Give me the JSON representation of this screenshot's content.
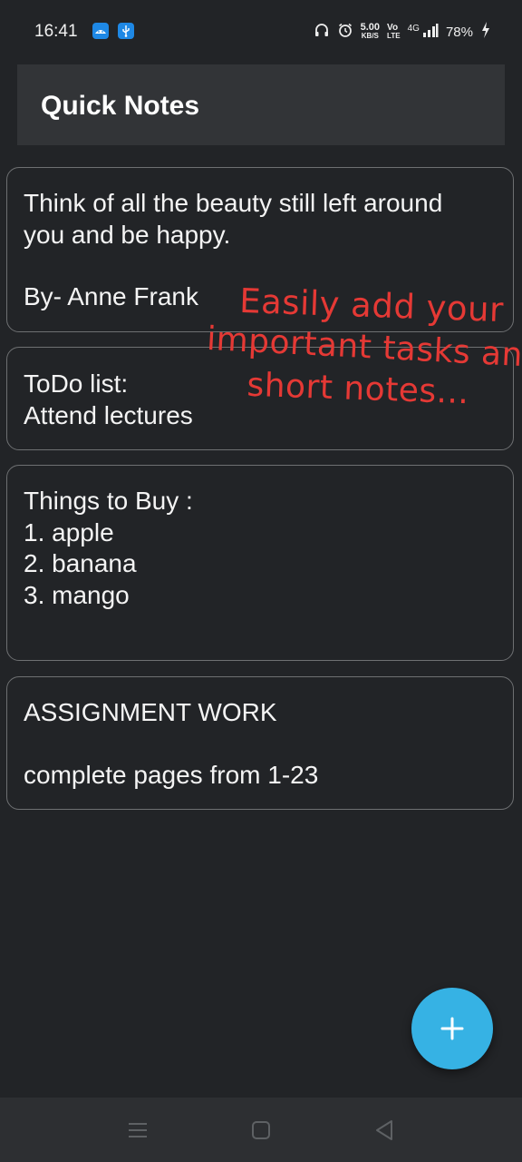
{
  "status_bar": {
    "time": "16:41",
    "net_speed_value": "5.00",
    "net_speed_unit": "KB/S",
    "volte_top": "Vo",
    "volte_bottom": "LTE",
    "signal_label": "4G",
    "battery": "78%"
  },
  "app_bar": {
    "title": "Quick Notes"
  },
  "notes": [
    {
      "lines": [
        "Think of all the beauty still left around",
        "you and be happy.",
        "",
        "By- Anne Frank"
      ]
    },
    {
      "lines": [
        "ToDo list:",
        "Attend lectures"
      ]
    },
    {
      "lines": [
        "Things to Buy :",
        "1. apple",
        "2. banana",
        "3. mango"
      ]
    },
    {
      "lines": [
        "ASSIGNMENT WORK",
        "",
        "complete pages from 1-23"
      ]
    }
  ],
  "promo": {
    "line1": "Easily add your",
    "line2": "important tasks and",
    "line3": "short notes..."
  },
  "fab": {
    "icon": "plus-icon",
    "color": "#36b2e4"
  },
  "colors": {
    "background": "#222427",
    "app_bar": "#323437",
    "promo_text": "#e53935"
  }
}
